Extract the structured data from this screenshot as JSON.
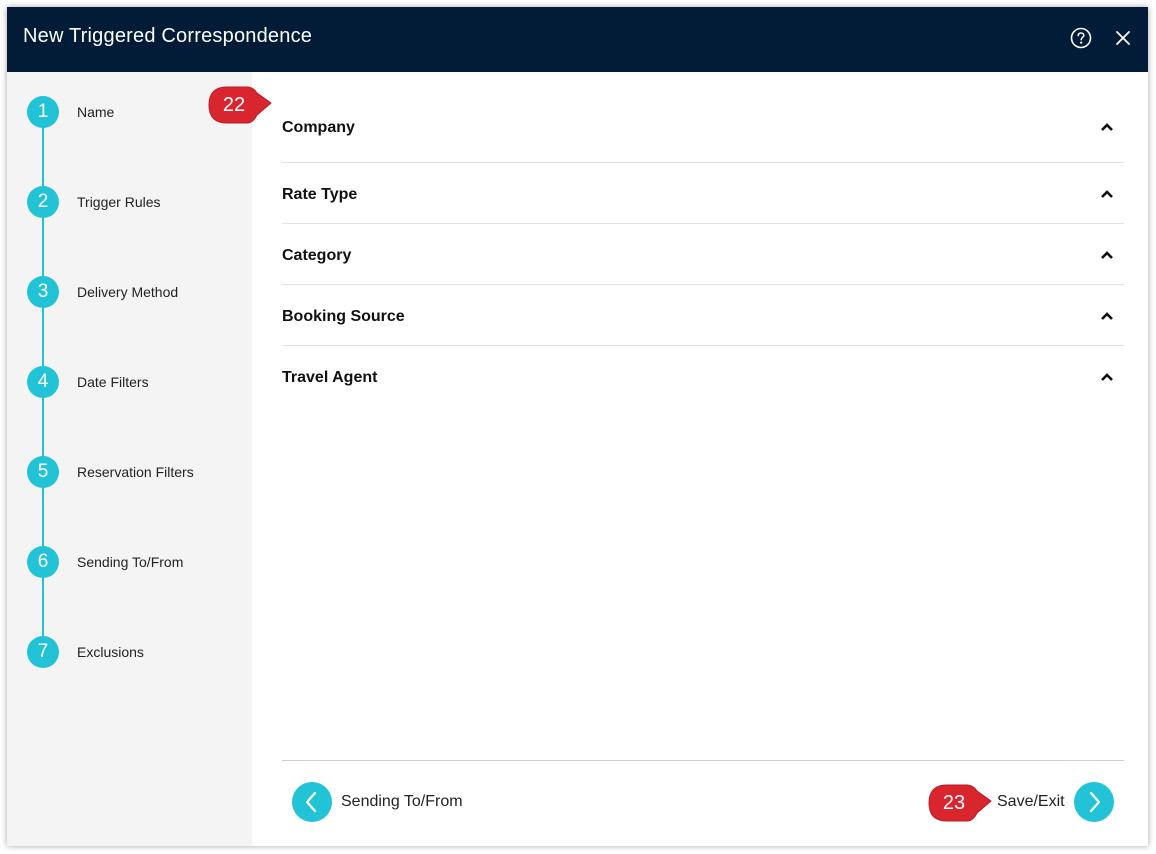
{
  "dialog": {
    "title": "New Triggered Correspondence",
    "help_icon": "help-circle-icon",
    "close_icon": "close-icon"
  },
  "steps": [
    {
      "number": "1",
      "label": "Name"
    },
    {
      "number": "2",
      "label": "Trigger Rules"
    },
    {
      "number": "3",
      "label": "Delivery Method"
    },
    {
      "number": "4",
      "label": "Date Filters"
    },
    {
      "number": "5",
      "label": "Reservation Filters"
    },
    {
      "number": "6",
      "label": "Sending To/From"
    },
    {
      "number": "7",
      "label": "Exclusions"
    }
  ],
  "sections": [
    {
      "label": "Company",
      "icon": "chevron-up-icon"
    },
    {
      "label": "Rate Type",
      "icon": "chevron-up-icon"
    },
    {
      "label": "Category",
      "icon": "chevron-up-icon"
    },
    {
      "label": "Booking Source",
      "icon": "chevron-up-icon"
    },
    {
      "label": "Travel Agent",
      "icon": "chevron-up-icon"
    }
  ],
  "footer": {
    "back_label": "Sending To/From",
    "next_label": "Save/Exit"
  },
  "callouts": {
    "first": "22",
    "second": "23"
  },
  "colors": {
    "titlebar": "#021c38",
    "accent": "#22c3d6",
    "sidebar": "#f4f4f4",
    "callout": "#d9262e"
  }
}
